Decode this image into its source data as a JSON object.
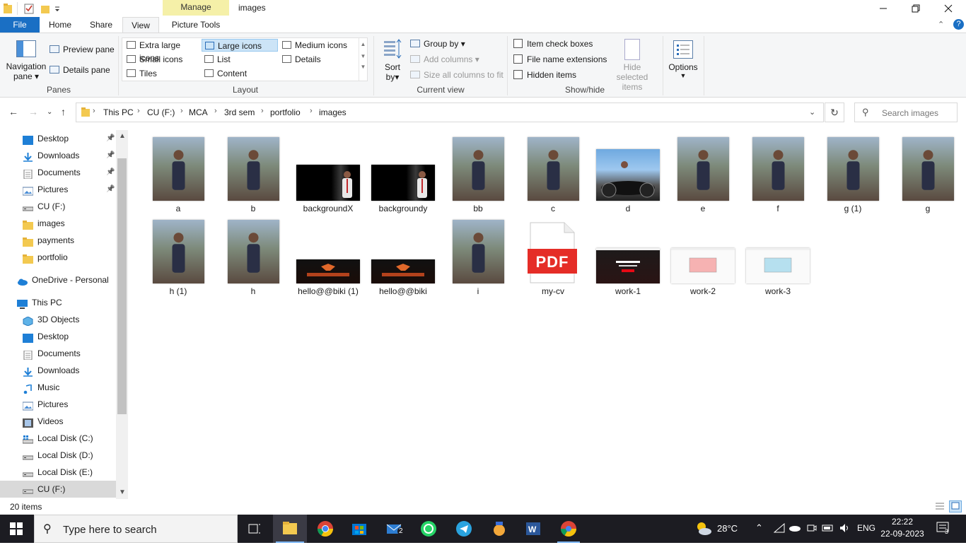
{
  "window": {
    "title": "images",
    "manage_label": "Manage",
    "minimize_icon": "minimize-icon",
    "maximize_icon": "restore-icon",
    "close_icon": "close-icon"
  },
  "ribbon_tabs": {
    "file": "File",
    "home": "Home",
    "share": "Share",
    "view": "View",
    "picture_tools": "Picture Tools"
  },
  "ribbon": {
    "panes": {
      "navigation_pane": "Navigation",
      "navigation_pane_2": "pane",
      "preview_pane": "Preview pane",
      "details_pane": "Details pane",
      "label": "Panes"
    },
    "layout": {
      "extra_large_icons": "Extra large icons",
      "large_icons": "Large icons",
      "medium_icons": "Medium icons",
      "small_icons": "Small icons",
      "list": "List",
      "details": "Details",
      "tiles": "Tiles",
      "content": "Content",
      "label": "Layout"
    },
    "current_view": {
      "sort": "Sort",
      "sort_2": "by",
      "group_by": "Group by",
      "add_columns": "Add columns",
      "size_columns": "Size all columns to fit",
      "label": "Current view"
    },
    "show_hide": {
      "item_check_boxes": "Item check boxes",
      "file_name_extensions": "File name extensions",
      "hidden_items": "Hidden items",
      "hide_selected": "Hide selected",
      "hide_selected_2": "items",
      "label": "Show/hide"
    },
    "options": "Options"
  },
  "address": {
    "crumbs": [
      "This PC",
      "CU (F:)",
      "MCA",
      "3rd sem",
      "portfolio",
      "images"
    ],
    "search_placeholder": "Search images"
  },
  "nav": {
    "quick": [
      {
        "label": "Desktop",
        "icon": "desktop-icon",
        "pinned": true
      },
      {
        "label": "Downloads",
        "icon": "downloads-icon",
        "pinned": true
      },
      {
        "label": "Documents",
        "icon": "documents-icon",
        "pinned": true
      },
      {
        "label": "Pictures",
        "icon": "pictures-icon",
        "pinned": true
      },
      {
        "label": "CU (F:)",
        "icon": "drive-icon",
        "pinned": false
      },
      {
        "label": "images",
        "icon": "folder-icon",
        "pinned": false
      },
      {
        "label": "payments",
        "icon": "folder-icon",
        "pinned": false
      },
      {
        "label": "portfolio",
        "icon": "folder-icon",
        "pinned": false
      }
    ],
    "onedrive": "OneDrive - Personal",
    "this_pc": "This PC",
    "pc_items": [
      {
        "label": "3D Objects",
        "icon": "3d-objects-icon"
      },
      {
        "label": "Desktop",
        "icon": "desktop-icon"
      },
      {
        "label": "Documents",
        "icon": "documents-icon"
      },
      {
        "label": "Downloads",
        "icon": "downloads-icon"
      },
      {
        "label": "Music",
        "icon": "music-icon"
      },
      {
        "label": "Pictures",
        "icon": "pictures-icon"
      },
      {
        "label": "Videos",
        "icon": "videos-icon"
      },
      {
        "label": "Local Disk (C:)",
        "icon": "windows-drive-icon"
      },
      {
        "label": "Local Disk (D:)",
        "icon": "drive-icon"
      },
      {
        "label": "Local Disk (E:)",
        "icon": "drive-icon"
      },
      {
        "label": "CU (F:)",
        "icon": "drive-icon"
      }
    ]
  },
  "files": [
    {
      "name": "a",
      "kind": "photo-portrait"
    },
    {
      "name": "b",
      "kind": "photo-portrait"
    },
    {
      "name": "backgroundX",
      "kind": "photo-wide-dark"
    },
    {
      "name": "backgroundy",
      "kind": "photo-wide-dark"
    },
    {
      "name": "bb",
      "kind": "photo-portrait"
    },
    {
      "name": "c",
      "kind": "photo-portrait"
    },
    {
      "name": "d",
      "kind": "photo-landscape"
    },
    {
      "name": "e",
      "kind": "photo-portrait"
    },
    {
      "name": "f",
      "kind": "photo-portrait"
    },
    {
      "name": "g (1)",
      "kind": "photo-portrait"
    },
    {
      "name": "g",
      "kind": "photo-portrait"
    },
    {
      "name": "h (1)",
      "kind": "photo-portrait"
    },
    {
      "name": "h",
      "kind": "photo-portrait"
    },
    {
      "name": "hello@@biki (1)",
      "kind": "banner-dark"
    },
    {
      "name": "hello@@biki",
      "kind": "banner-dark"
    },
    {
      "name": "i",
      "kind": "photo-portrait"
    },
    {
      "name": "my-cv",
      "kind": "pdf"
    },
    {
      "name": "work-1",
      "kind": "screenshot-dark"
    },
    {
      "name": "work-2",
      "kind": "screenshot-light"
    },
    {
      "name": "work-3",
      "kind": "screenshot-light"
    }
  ],
  "pdf_label": "PDF",
  "status": {
    "count": "20 items"
  },
  "taskbar": {
    "search_placeholder": "Type here to search",
    "weather": "28°C",
    "language": "ENG",
    "time": "22:22",
    "date": "22-09-2023",
    "mail_badge": "2",
    "notification_badge": "3"
  },
  "colors": {
    "accent": "#1a6fc4",
    "manage": "#f5f0a8",
    "selected_layout": "#cce4f7",
    "taskbar": "#1c1c22"
  }
}
